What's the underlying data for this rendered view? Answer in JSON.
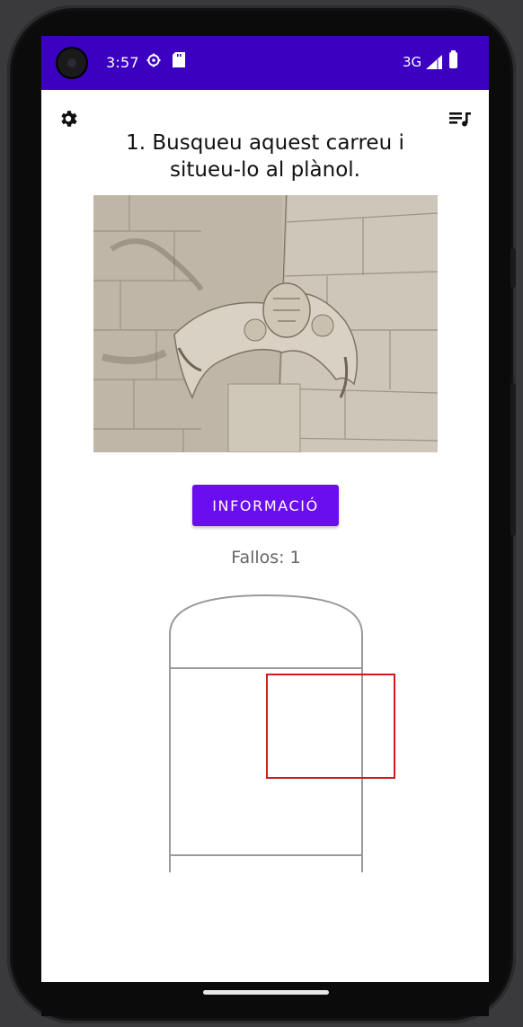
{
  "status_bar": {
    "time": "3:57",
    "network": "3G",
    "icons": [
      "camera-icon",
      "settings-status-icon",
      "sd-card-icon",
      "signal-icon",
      "battery-icon"
    ],
    "color": "#3c00c0"
  },
  "toolbar": {
    "settings_icon": "gear-icon",
    "playlist_icon": "playlist-icon"
  },
  "page": {
    "title": "1. Busqueu aquest carreu i situeu-lo al plànol.",
    "info_button": "INFORMACIÓ",
    "errors_text": "Fallos: 1"
  },
  "colors": {
    "accent": "#6a0ef0",
    "selection": "#d11a1a",
    "plan_outline": "#9a9a9a"
  }
}
